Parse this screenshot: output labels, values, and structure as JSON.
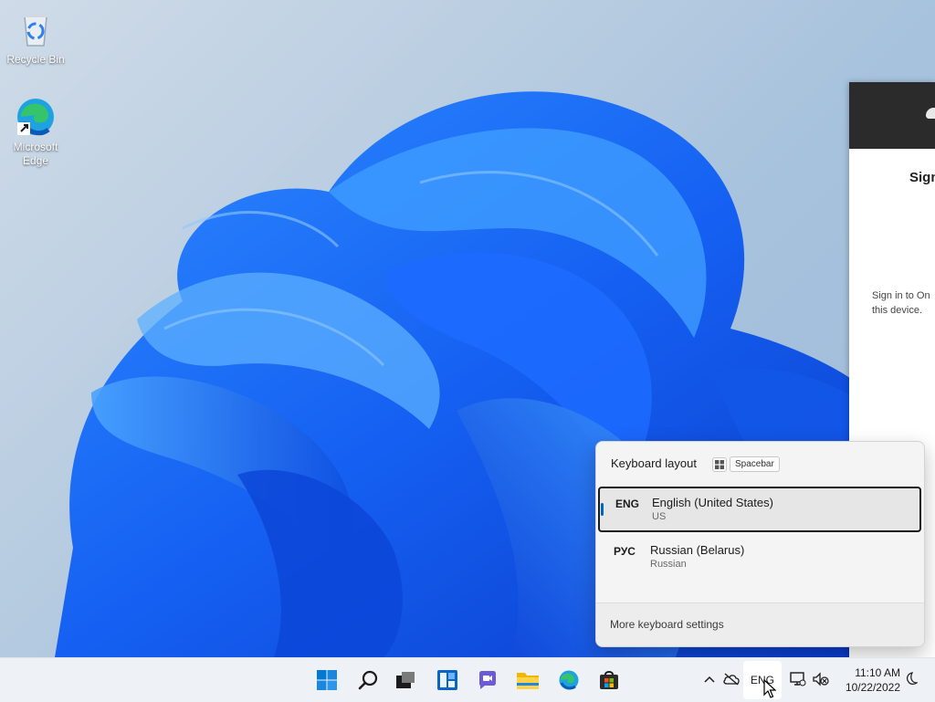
{
  "desktop": {
    "icons": [
      {
        "label": "Recycle Bin",
        "icon": "recycle-bin-icon"
      },
      {
        "label": "Microsoft Edge",
        "icon": "edge-icon"
      }
    ]
  },
  "onedrive_window": {
    "title": "Sign",
    "body_line1": "Sign in to On",
    "body_line2": "this device."
  },
  "keyboard_flyout": {
    "header": "Keyboard layout",
    "shortcut_key": "Spacebar",
    "items": [
      {
        "code": "ENG",
        "name": "English (United States)",
        "layout": "US",
        "selected": true
      },
      {
        "code": "РУС",
        "name": "Russian (Belarus)",
        "layout": "Russian",
        "selected": false
      }
    ],
    "footer_link": "More keyboard settings"
  },
  "taskbar": {
    "pinned": [
      "start-icon",
      "search-icon",
      "task-view-icon",
      "widgets-icon",
      "chat-icon",
      "file-explorer-icon",
      "edge-icon",
      "store-icon"
    ],
    "tray": {
      "language": "ENG",
      "time": "11:10 AM",
      "date": "10/22/2022"
    }
  },
  "colors": {
    "accent": "#0067c0",
    "bloom": "#1a5ff0"
  }
}
